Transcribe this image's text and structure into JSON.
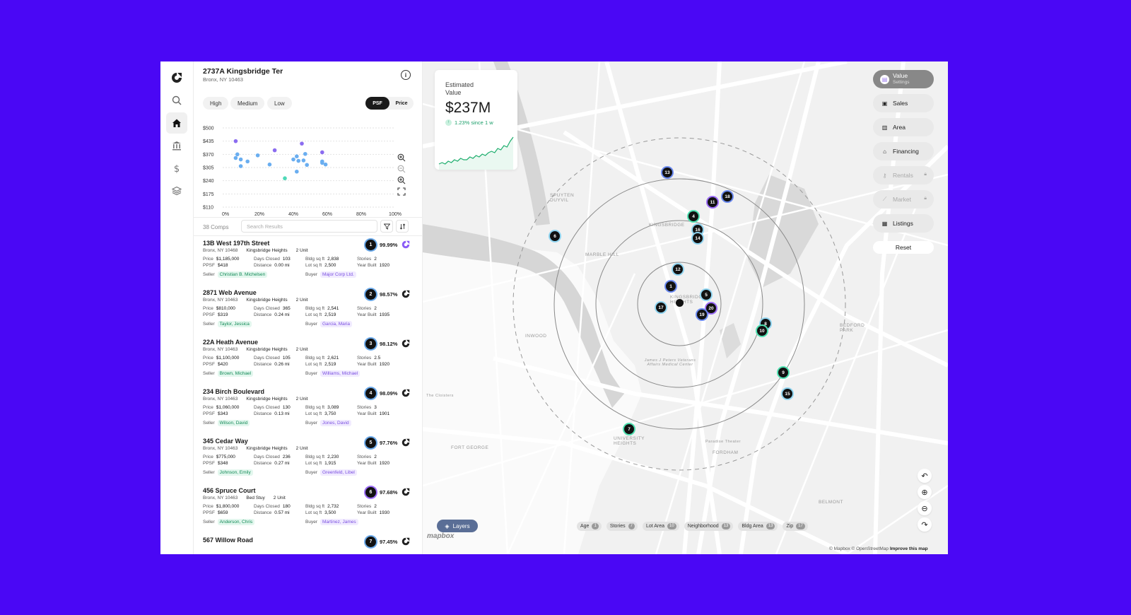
{
  "property": {
    "title": "2737A Kingsbridge Ter",
    "subtitle": "Bronx, NY 10463"
  },
  "info_icon": "info-icon",
  "rail": [
    "logo-icon",
    "search-icon",
    "home-icon",
    "bank-icon",
    "dollar-icon",
    "layers-icon"
  ],
  "filter_pills": [
    "High",
    "Medium",
    "Low"
  ],
  "toggle": {
    "left": "PSF",
    "right": "Price",
    "selected": "PSF"
  },
  "chart_data": {
    "type": "scatter",
    "title": "",
    "xlabel": "",
    "ylabel": "",
    "x_ticks": [
      "0%",
      "20%",
      "40%",
      "60%",
      "80%",
      "100%"
    ],
    "y_ticks": [
      "$500",
      "$435",
      "$370",
      "$305",
      "$240",
      "$175",
      "$110"
    ],
    "xlim": [
      0,
      100
    ],
    "ylim": [
      110,
      500
    ],
    "grid": true,
    "points": [
      {
        "x": 6,
        "y": 435,
        "c": "#8b6cf0"
      },
      {
        "x": 45,
        "y": 423,
        "c": "#8b6cf0"
      },
      {
        "x": 29,
        "y": 390,
        "c": "#8b6cf0"
      },
      {
        "x": 57,
        "y": 380,
        "c": "#8b6cf0"
      },
      {
        "x": 7,
        "y": 370,
        "c": "#6aaef0"
      },
      {
        "x": 47,
        "y": 372,
        "c": "#6aaef0"
      },
      {
        "x": 19,
        "y": 365,
        "c": "#6aaef0"
      },
      {
        "x": 42,
        "y": 360,
        "c": "#6aaef0"
      },
      {
        "x": 6,
        "y": 352,
        "c": "#6aaef0"
      },
      {
        "x": 40,
        "y": 345,
        "c": "#6aaef0"
      },
      {
        "x": 9,
        "y": 345,
        "c": "#6aaef0"
      },
      {
        "x": 46,
        "y": 340,
        "c": "#6aaef0"
      },
      {
        "x": 13,
        "y": 335,
        "c": "#6aaef0"
      },
      {
        "x": 43,
        "y": 338,
        "c": "#6aaef0"
      },
      {
        "x": 57,
        "y": 335,
        "c": "#6aaef0"
      },
      {
        "x": 57,
        "y": 328,
        "c": "#6aaef0"
      },
      {
        "x": 48,
        "y": 318,
        "c": "#6aaef0"
      },
      {
        "x": 26,
        "y": 320,
        "c": "#6aaef0"
      },
      {
        "x": 9,
        "y": 312,
        "c": "#6aaef0"
      },
      {
        "x": 42,
        "y": 285,
        "c": "#6aaef0"
      },
      {
        "x": 35,
        "y": 252,
        "c": "#4fd9b8"
      },
      {
        "x": 59,
        "y": 320,
        "c": "#6aaef0"
      }
    ]
  },
  "chart_tools": [
    "zoom-in-icon",
    "zoom-out-icon",
    "zoom-in-icon",
    "expand-icon"
  ],
  "comps": {
    "count": "38 Comps",
    "search_placeholder": "Search Results",
    "items": [
      {
        "rank": "1",
        "name": "13B West 197th Street",
        "city": "Bronx, NY 10468",
        "nbhd": "Kingsbridge Heights",
        "units": "2 Unit",
        "pct": "99.99%",
        "price": "$1,185,000",
        "ppsf": "$418",
        "days": "103",
        "dist": "0.00 mi",
        "bldg": "2,838",
        "lot": "2,500",
        "stories": "2",
        "year": "1920",
        "seller": "Christian B. Michelsen",
        "buyer": "Major Corp Ltd.",
        "ring": "blue"
      },
      {
        "rank": "2",
        "name": "2871 Web Avenue",
        "city": "Bronx, NY 10463",
        "nbhd": "Kingsbridge Heights",
        "units": "2 Unit",
        "pct": "98.57%",
        "price": "$810,000",
        "ppsf": "$319",
        "days": "365",
        "dist": "0.24 mi",
        "bldg": "2,541",
        "lot": "2,519",
        "stories": "2",
        "year": "1935",
        "seller": "Taylor, Jessica",
        "buyer": "Garcia, Maria",
        "ring": "blue"
      },
      {
        "rank": "3",
        "name": "22A Heath Avenue",
        "city": "Bronx, NY 10463",
        "nbhd": "Kingsbridge Heights",
        "units": "2 Unit",
        "pct": "98.12%",
        "price": "$1,100,000",
        "ppsf": "$420",
        "days": "105",
        "dist": "0.26 mi",
        "bldg": "2,621",
        "lot": "2,519",
        "stories": "2.5",
        "year": "1920",
        "seller": "Brown, Michael",
        "buyer": "Williams, Michael",
        "ring": "blue"
      },
      {
        "rank": "4",
        "name": "234 Birch Boulevard",
        "city": "Bronx, NY 10463",
        "nbhd": "Kingsbridge Heights",
        "units": "2 Unit",
        "pct": "98.09%",
        "price": "$1,060,000",
        "ppsf": "$343",
        "days": "130",
        "dist": "0.13 mi",
        "bldg": "3,089",
        "lot": "3,750",
        "stories": "3",
        "year": "1901",
        "seller": "Wilson, David",
        "buyer": "Jones, David",
        "ring": "blue"
      },
      {
        "rank": "5",
        "name": "345 Cedar Way",
        "city": "Bronx, NY 10463",
        "nbhd": "Kingsbridge Heights",
        "units": "2 Unit",
        "pct": "97.76%",
        "price": "$775,000",
        "ppsf": "$348",
        "days": "236",
        "dist": "0.27 mi",
        "bldg": "2,230",
        "lot": "1,915",
        "stories": "2",
        "year": "1920",
        "seller": "Johnson, Emily",
        "buyer": "Greenfeld, Libel",
        "ring": "blue"
      },
      {
        "rank": "6",
        "name": "456 Spruce Court",
        "city": "Bronx, NY 10463",
        "nbhd": "Bed Stuy",
        "units": "2 Unit",
        "pct": "97.68%",
        "price": "$1,800,000",
        "ppsf": "$659",
        "days": "180",
        "dist": "0.57 mi",
        "bldg": "2,732",
        "lot": "3,500",
        "stories": "2",
        "year": "1930",
        "seller": "Anderson, Chris",
        "buyer": "Martinez, James",
        "ring": "purple"
      },
      {
        "rank": "7",
        "name": "567 Willow Road",
        "city": "",
        "nbhd": "",
        "units": "",
        "pct": "97.45%",
        "price": "",
        "ppsf": "",
        "days": "",
        "dist": "",
        "bldg": "",
        "lot": "",
        "stories": "",
        "year": "",
        "seller": "",
        "buyer": "",
        "ring": "blue"
      }
    ],
    "labels": {
      "price": "Price",
      "ppsf": "PPSF",
      "days": "Days Closed",
      "dist": "Distance",
      "bldg": "Bldg sq ft",
      "lot": "Lot sq ft",
      "stories": "Stories",
      "year": "Year Built",
      "seller": "Seller",
      "buyer": "Buyer"
    }
  },
  "estimate": {
    "label": "Estimated Value",
    "value": "$237M",
    "change": "1.23% since 1 w",
    "spark": [
      3,
      4,
      3,
      5,
      4,
      6,
      5,
      7,
      6,
      6,
      8,
      7,
      9,
      8,
      10,
      9,
      11,
      12,
      11,
      14,
      13,
      16,
      15,
      19,
      22
    ]
  },
  "side_menu": [
    {
      "label": "Value",
      "sub": "Settings",
      "icon": "value-icon",
      "glyph": "▤",
      "state": "active"
    },
    {
      "label": "Sales",
      "icon": "sales-icon",
      "glyph": "▣",
      "state": "normal"
    },
    {
      "label": "Area",
      "icon": "area-icon",
      "glyph": "▥",
      "state": "normal"
    },
    {
      "label": "Financing",
      "icon": "bank-icon",
      "glyph": "⌂",
      "state": "normal"
    },
    {
      "label": "Rentals",
      "icon": "key-icon",
      "glyph": "⚷",
      "state": "locked"
    },
    {
      "label": "Market",
      "icon": "chart-icon",
      "glyph": "⟋",
      "state": "locked"
    },
    {
      "label": "Listings",
      "icon": "listings-icon",
      "glyph": "▦",
      "state": "normal"
    }
  ],
  "reset_label": "Reset",
  "layers_label": "Layers",
  "map_filters": [
    {
      "label": "Age",
      "n": "1"
    },
    {
      "label": "Stories",
      "n": "7"
    },
    {
      "label": "Lot Area",
      "n": "10"
    },
    {
      "label": "Neighborhood",
      "n": "13"
    },
    {
      "label": "Bldg Area",
      "n": "13"
    },
    {
      "label": "Zip",
      "n": "17"
    }
  ],
  "map_labels": [
    "KINGSBRIDGE",
    "MARBLE HILL",
    "SPUYTEN DUYVIL",
    "INWOOD",
    "FORT GEORGE",
    "UNIVERSITY HEIGHTS",
    "BEDFORD PARK",
    "FORDHAM",
    "BELMONT",
    "KINGSBRIDGE HEIGHTS",
    "James J Peters Veterans Affairs Medical Center",
    "Paradise Theater",
    "The Cloisters"
  ],
  "map_pins": [
    {
      "n": "13",
      "c": "blue"
    },
    {
      "n": "18",
      "c": "blue"
    },
    {
      "n": "11",
      "c": "purple"
    },
    {
      "n": "4",
      "c": "green"
    },
    {
      "n": "16",
      "c": "sky"
    },
    {
      "n": "14",
      "c": "sky"
    },
    {
      "n": "6",
      "c": "sky"
    },
    {
      "n": "12",
      "c": "sky"
    },
    {
      "n": "1",
      "c": "blue"
    },
    {
      "n": "5",
      "c": "sky"
    },
    {
      "n": "20",
      "c": "purple"
    },
    {
      "n": "17",
      "c": "sky"
    },
    {
      "n": "19",
      "c": "blue"
    },
    {
      "n": "8",
      "c": "sky"
    },
    {
      "n": "10",
      "c": "green"
    },
    {
      "n": "9",
      "c": "green"
    },
    {
      "n": "15",
      "c": "sky"
    },
    {
      "n": "7",
      "c": "green"
    }
  ],
  "attribution": {
    "text": "© Mapbox © OpenStreetMap",
    "link": "Improve this map"
  },
  "mapbox_logo": "mapbox"
}
